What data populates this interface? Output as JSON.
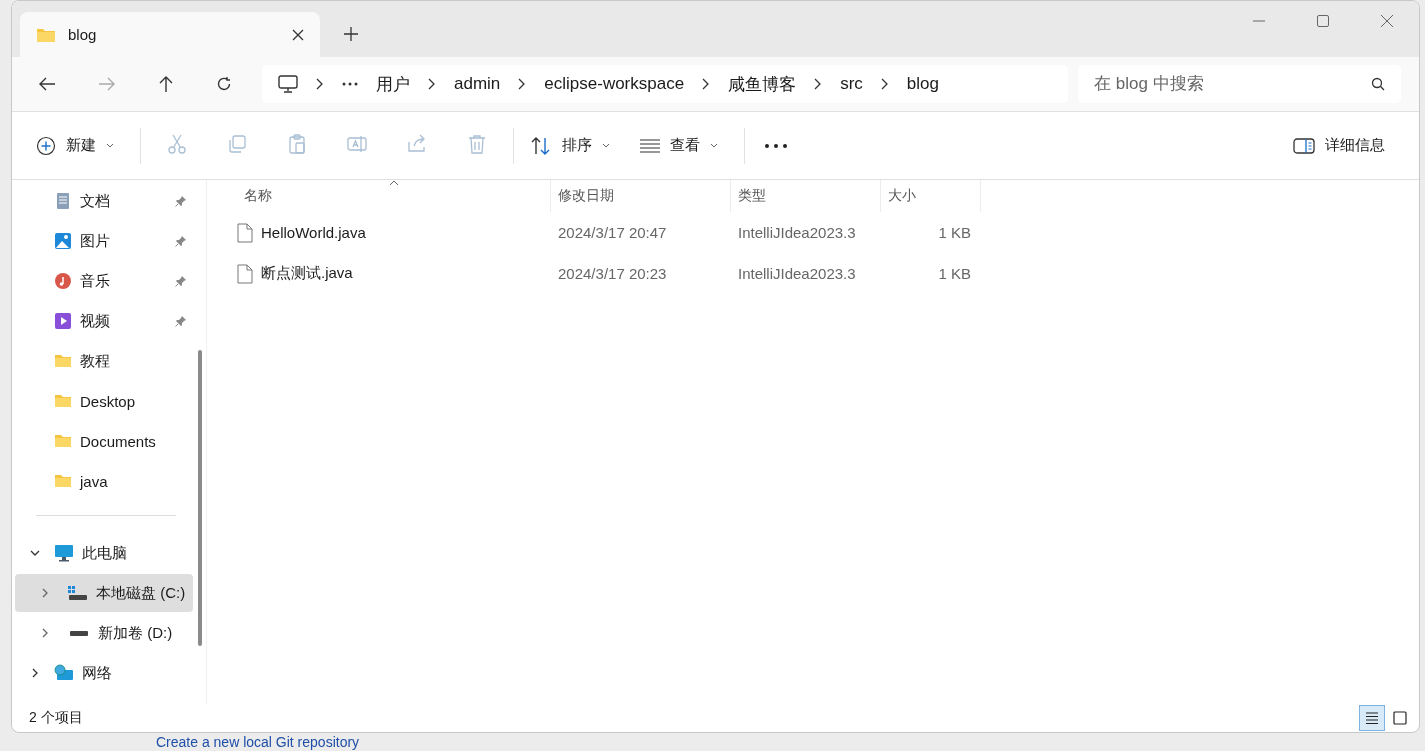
{
  "tab": {
    "title": "blog",
    "selected": true
  },
  "address": {
    "crumbs": [
      "用户",
      "admin",
      "eclipse-workspace",
      "咸鱼博客",
      "src",
      "blog"
    ]
  },
  "search": {
    "placeholder": "在 blog 中搜索"
  },
  "toolbar": {
    "new_label": "新建",
    "actions": [
      {
        "kind": "cut",
        "disabled": true
      },
      {
        "kind": "copy",
        "disabled": true
      },
      {
        "kind": "paste",
        "disabled": true
      },
      {
        "kind": "rename",
        "disabled": true
      },
      {
        "kind": "share",
        "disabled": true
      },
      {
        "kind": "delete",
        "disabled": true
      }
    ],
    "sort_label": "排序",
    "view_label": "查看",
    "details_label": "详细信息"
  },
  "sidebar": {
    "items": [
      {
        "label": "文档",
        "kind": "documents",
        "pinned": true,
        "selected": false
      },
      {
        "label": "图片",
        "kind": "pictures",
        "pinned": true,
        "selected": false
      },
      {
        "label": "音乐",
        "kind": "music",
        "pinned": true,
        "selected": false
      },
      {
        "label": "视频",
        "kind": "videos",
        "pinned": true,
        "selected": false
      },
      {
        "label": "教程",
        "kind": "folder",
        "pinned": false,
        "selected": false
      },
      {
        "label": "Desktop",
        "kind": "folder",
        "pinned": false,
        "selected": false
      },
      {
        "label": "Documents",
        "kind": "folder",
        "pinned": false,
        "selected": false
      },
      {
        "label": "java",
        "kind": "folder",
        "pinned": false,
        "selected": false
      }
    ],
    "tree": [
      {
        "label": "此电脑",
        "kind": "pc",
        "expanded": true,
        "selected": false,
        "children": [
          {
            "label": "本地磁盘 (C:)",
            "kind": "system-drive",
            "expanded": false,
            "selected": true
          },
          {
            "label": "新加卷 (D:)",
            "kind": "drive",
            "expanded": false,
            "selected": false
          }
        ]
      },
      {
        "label": "网络",
        "kind": "network",
        "expanded": false,
        "selected": false
      }
    ]
  },
  "table": {
    "columns": [
      {
        "label": "名称",
        "sorted": true
      },
      {
        "label": "修改日期",
        "sorted": false
      },
      {
        "label": "类型",
        "sorted": false
      },
      {
        "label": "大小",
        "sorted": false
      }
    ],
    "rows": [
      {
        "name": "HelloWorld.java",
        "date": "2024/3/17 20:47",
        "type": "IntelliJIdea2023.3",
        "size": "1 KB"
      },
      {
        "name": "断点测试.java",
        "date": "2024/3/17 20:23",
        "type": "IntelliJIdea2023.3",
        "size": "1 KB"
      }
    ]
  },
  "status_bar": {
    "count": "2 个项目",
    "views": [
      {
        "kind": "details",
        "selected": true
      },
      {
        "kind": "tiles",
        "selected": false
      }
    ]
  },
  "background_window": {
    "link": "Create a new local Git repository"
  }
}
